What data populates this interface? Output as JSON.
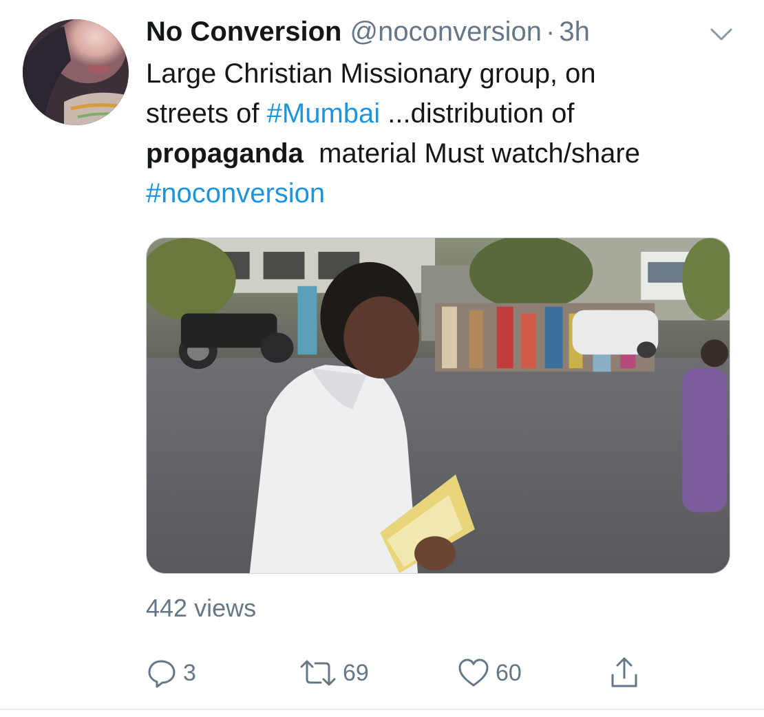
{
  "tweet": {
    "author": {
      "display_name": "No Conversion",
      "handle": "@noconversion",
      "separator": "·",
      "time": "3h",
      "avatar_icon": "profile-photo"
    },
    "text": {
      "line1": "Large Christian Missionary group, on",
      "line2_pre": "streets of ",
      "hashtag1": "#Mumbai",
      "line2_post": " ...distribution of",
      "bold_word": "propaganda",
      "line3_post": "  material Must watch/share",
      "hashtag2": "#noconversion"
    },
    "media": {
      "kind": "video"
    },
    "views": "442 views",
    "actions": {
      "reply": {
        "icon": "reply-icon",
        "count": "3"
      },
      "retweet": {
        "icon": "retweet-icon",
        "count": "69"
      },
      "like": {
        "icon": "heart-icon",
        "count": "60"
      },
      "share": {
        "icon": "share-icon"
      }
    },
    "colors": {
      "link": "#1b95e0",
      "secondary_text": "#657786",
      "primary_text": "#14171a"
    }
  }
}
